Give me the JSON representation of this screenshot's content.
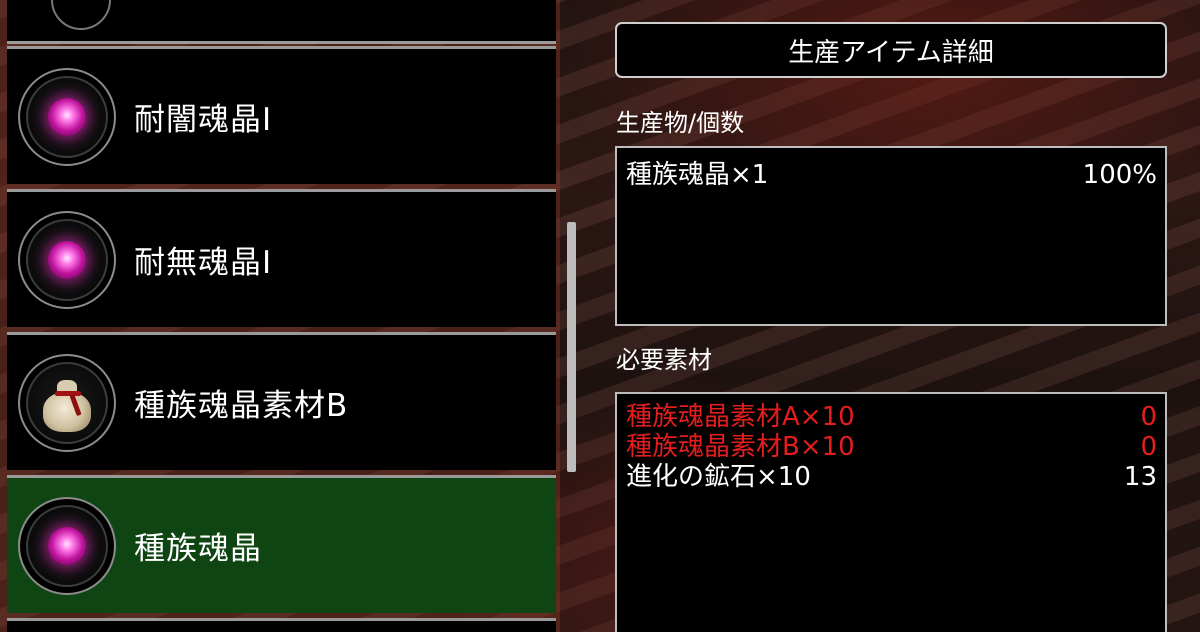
{
  "list": {
    "items": [
      {
        "label": "耐闇魂晶Ⅰ",
        "icon": "pink-gem-icon",
        "selected": false
      },
      {
        "label": "耐無魂晶Ⅰ",
        "icon": "pink-gem-icon",
        "selected": false
      },
      {
        "label": "種族魂晶素材B",
        "icon": "cloth-bag-icon",
        "selected": false
      },
      {
        "label": "種族魂晶",
        "icon": "pink-gem-icon",
        "selected": true
      }
    ]
  },
  "detail": {
    "title": "生産アイテム詳細",
    "product_label": "生産物/個数",
    "product": {
      "name": "種族魂晶×1",
      "rate": "100%"
    },
    "materials_label": "必要素材",
    "materials": [
      {
        "name": "種族魂晶素材A×10",
        "owned": "0",
        "status": "insufficient"
      },
      {
        "name": "種族魂晶素材B×10",
        "owned": "0",
        "status": "insufficient"
      },
      {
        "name": "進化の鉱石×10",
        "owned": "13",
        "status": "sufficient"
      }
    ]
  },
  "colors": {
    "selected_row": "#0f4413",
    "insufficient_text": "#e41d1d",
    "gem": "#c0139d"
  }
}
